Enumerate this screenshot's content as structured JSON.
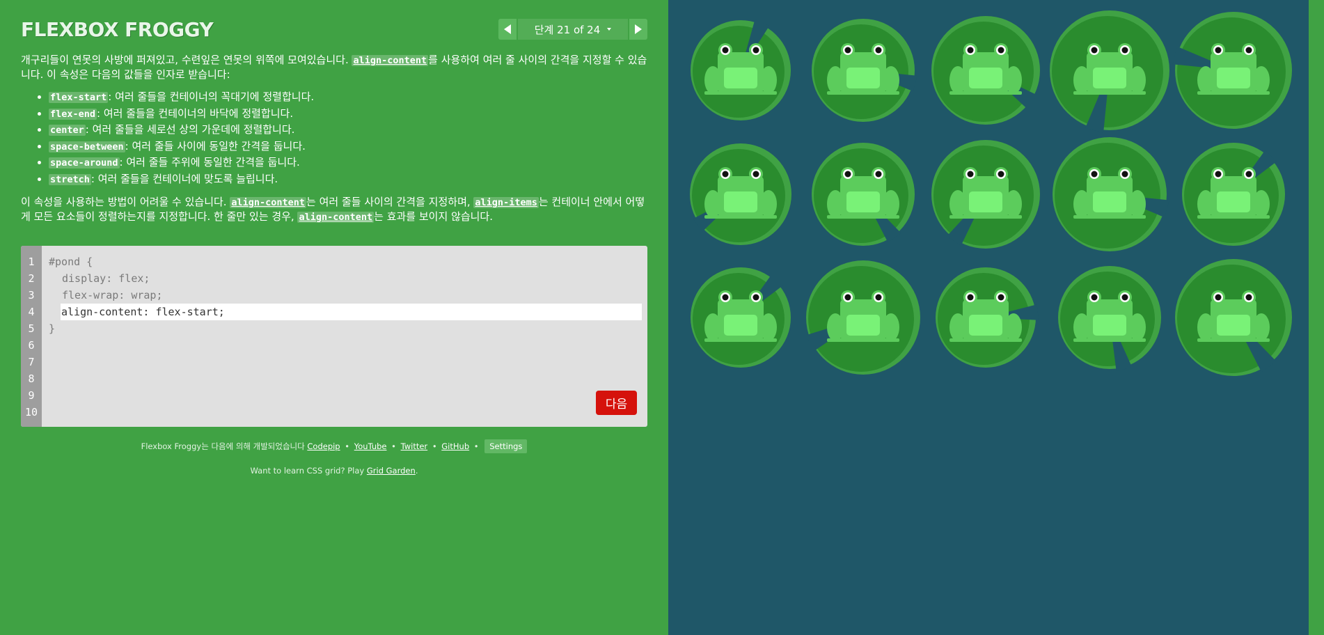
{
  "logo": "FLEXBOX FROGGY",
  "level": {
    "indicator": "단계 21 of 24",
    "current": 21,
    "total": 24
  },
  "instructions": {
    "intro_1": "개구리들이 연못의 사방에 퍼져있고, 수련잎은 연못의 위쪽에 모여있습니다. ",
    "intro_code": "align-content",
    "intro_2": "를 사용하여 여러 줄 사이의 간격을 지정할 수 있습니다. 이 속성은 다음의 값들을 인자로 받습니다:",
    "values": [
      {
        "code": "flex-start",
        "text": ": 여러 줄들을 컨테이너의 꼭대기에 정렬합니다."
      },
      {
        "code": "flex-end",
        "text": ": 여러 줄들을 컨테이너의 바닥에 정렬합니다."
      },
      {
        "code": "center",
        "text": ": 여러 줄들을 세로선 상의 가운데에 정렬합니다."
      },
      {
        "code": "space-between",
        "text": ": 여러 줄들 사이에 동일한 간격을 둡니다."
      },
      {
        "code": "space-around",
        "text": ": 여러 줄들 주위에 동일한 간격을 둡니다."
      },
      {
        "code": "stretch",
        "text": ": 여러 줄들을 컨테이너에 맞도록 늘립니다."
      }
    ],
    "note_1": "이 속성을 사용하는 방법이 어려울 수 있습니다. ",
    "note_code_1": "align-content",
    "note_2": "는 여러 줄들 사이의 간격을 지정하며, ",
    "note_code_2": "align-items",
    "note_3": "는 컨테이너 안에서 어떻게 모든 요소들이 정렬하는지를 지정합니다. 한 줄만 있는 경우, ",
    "note_code_3": "align-content",
    "note_4": "는 효과를 보이지 않습니다."
  },
  "editor": {
    "line_numbers": [
      "1",
      "2",
      "3",
      "4",
      "5",
      "6",
      "7",
      "8",
      "9",
      "10"
    ],
    "line_1": "#pond {",
    "line_2": "display: flex;",
    "line_3": "flex-wrap: wrap;",
    "input_value": "align-content: flex-start;",
    "line_5": "}",
    "next_label": "다음"
  },
  "credits": {
    "text": "Flexbox Froggy는 다음에 의해 개발되었습니다 ",
    "links": [
      "Codepip",
      "YouTube",
      "Twitter",
      "GitHub"
    ],
    "separator": "•",
    "settings_label": "Settings"
  },
  "footer": {
    "text": "Want to learn CSS grid? Play ",
    "link": "Grid Garden",
    "end": "."
  },
  "colors": {
    "sidebar_bg": "#40a244",
    "pond_bg": "#1f5768",
    "lilypad": "#2a8c2e",
    "lilypad_rim": "#40a244",
    "frog": "#5ccc5c",
    "frog_belly": "#79f277",
    "next_button": "#d5120c"
  },
  "pond": {
    "frogs": 15,
    "lilypads": 15
  }
}
